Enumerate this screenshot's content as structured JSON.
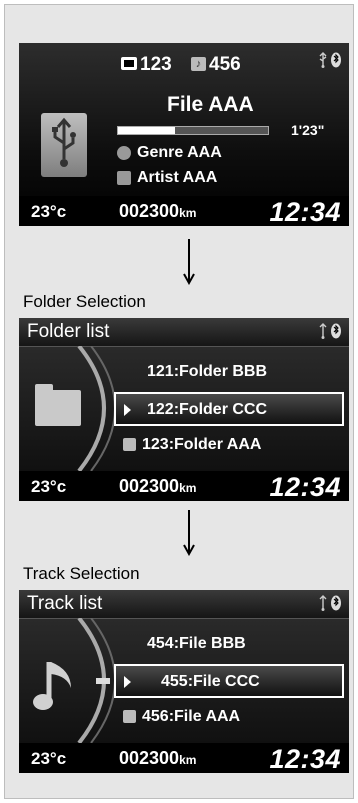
{
  "now_playing": {
    "folder_count": "123",
    "track_count": "456",
    "title": "File AAA",
    "time": "1'23\"",
    "genre": "Genre AAA",
    "artist": "Artist AAA",
    "progress_fraction": 0.38
  },
  "status": {
    "temperature": "23°c",
    "odometer": "002300",
    "odometer_unit": "km",
    "clock": "12:34"
  },
  "folder_selection": {
    "label": "Folder Selection",
    "title": "Folder list",
    "items": [
      "121:Folder BBB",
      "122:Folder CCC",
      "123:Folder AAA"
    ]
  },
  "track_selection": {
    "label": "Track Selection",
    "title": "Track list",
    "items": [
      "454:File BBB",
      "455:File CCC",
      "456:File AAA"
    ]
  }
}
